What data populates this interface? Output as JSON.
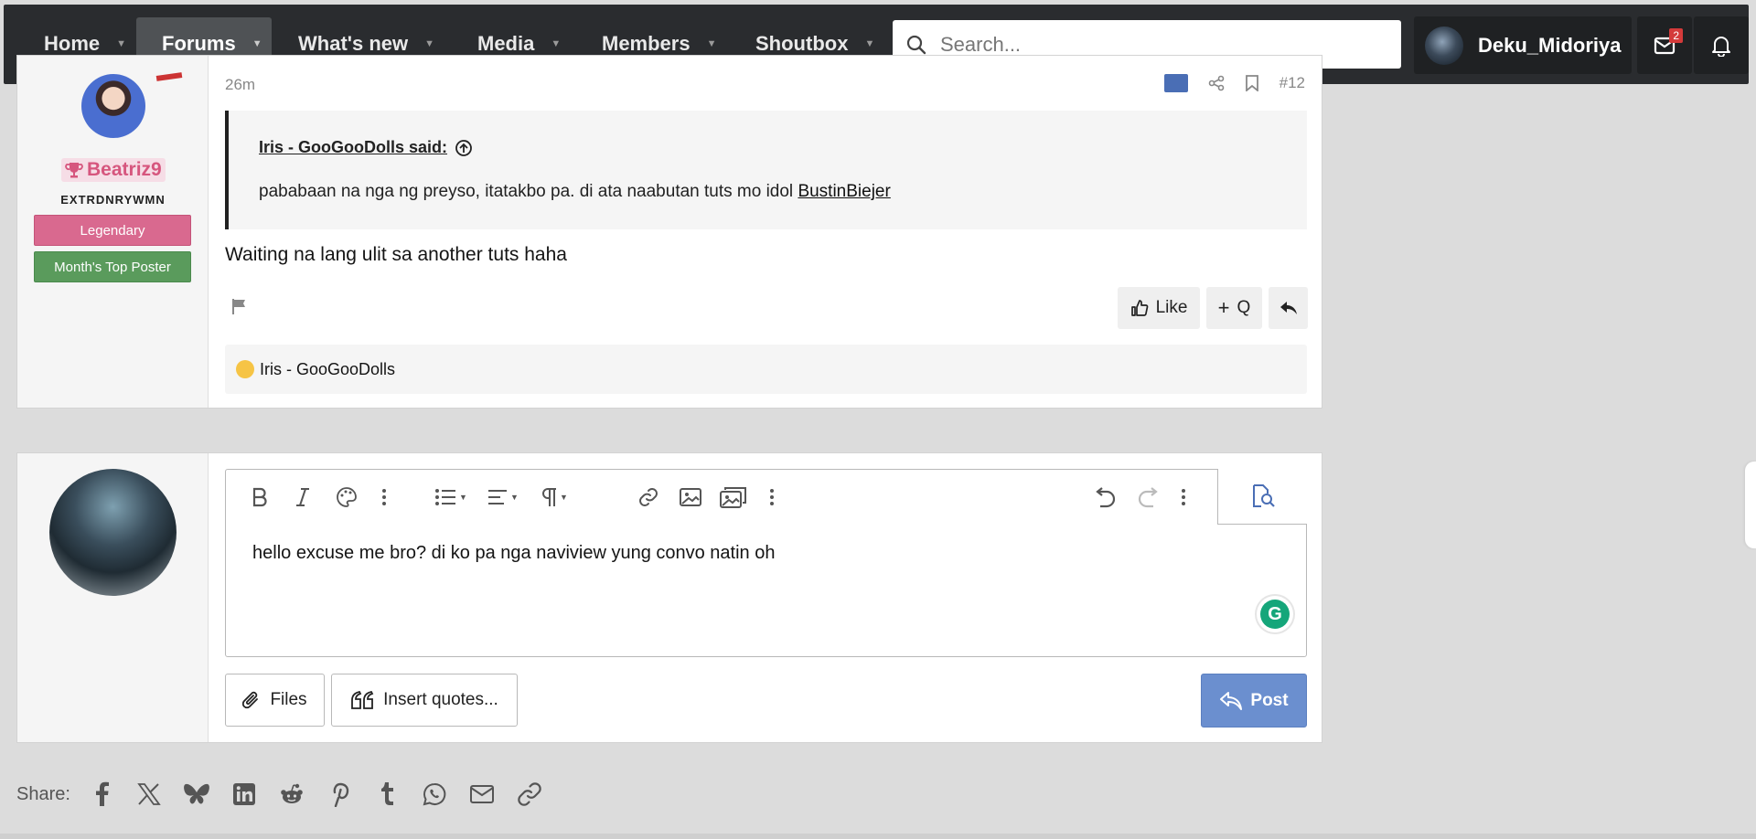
{
  "nav": {
    "items": [
      {
        "label": "Home",
        "active": false
      },
      {
        "label": "Forums",
        "active": true
      },
      {
        "label": "What's new",
        "active": false
      },
      {
        "label": "Media",
        "active": false
      },
      {
        "label": "Members",
        "active": false
      },
      {
        "label": "Shoutbox",
        "active": false
      }
    ],
    "search_placeholder": "Search...",
    "username": "Deku_Midoriya",
    "inbox_count": "2"
  },
  "post": {
    "time": "26m",
    "number": "#12",
    "author": {
      "name": "Beatriz9",
      "title": "EXTRDNRYWMN",
      "banners": [
        "Legendary",
        "Month's Top Poster"
      ]
    },
    "quote": {
      "author": "Iris - GooGooDolls said:",
      "text": "pababaan na nga ng preyso, itatakbo pa. di ata naabutan tuts mo idol ",
      "link": "BustinBiejer"
    },
    "body": "Waiting na lang ulit sa another tuts haha",
    "actions": {
      "like": "Like",
      "quote": "Q"
    },
    "reaction_user": "Iris - GooGooDolls"
  },
  "reply": {
    "text": "hello excuse me bro? di ko pa nga naviview yung convo natin oh",
    "files_label": "Files",
    "insert_quotes_label": "Insert quotes...",
    "post_label": "Post"
  },
  "share": {
    "label": "Share:",
    "icons": [
      "facebook-icon",
      "x-icon",
      "bluesky-icon",
      "linkedin-icon",
      "reddit-icon",
      "pinterest-icon",
      "tumblr-icon",
      "whatsapp-icon",
      "email-icon",
      "link-icon"
    ]
  },
  "colors": {
    "nav_bg": "#2a2c2f",
    "accent": "#6b8fcf",
    "username_pink": "#d6567e",
    "banner_legendary": "#d9698f",
    "banner_top_poster": "#5a9b5c"
  }
}
